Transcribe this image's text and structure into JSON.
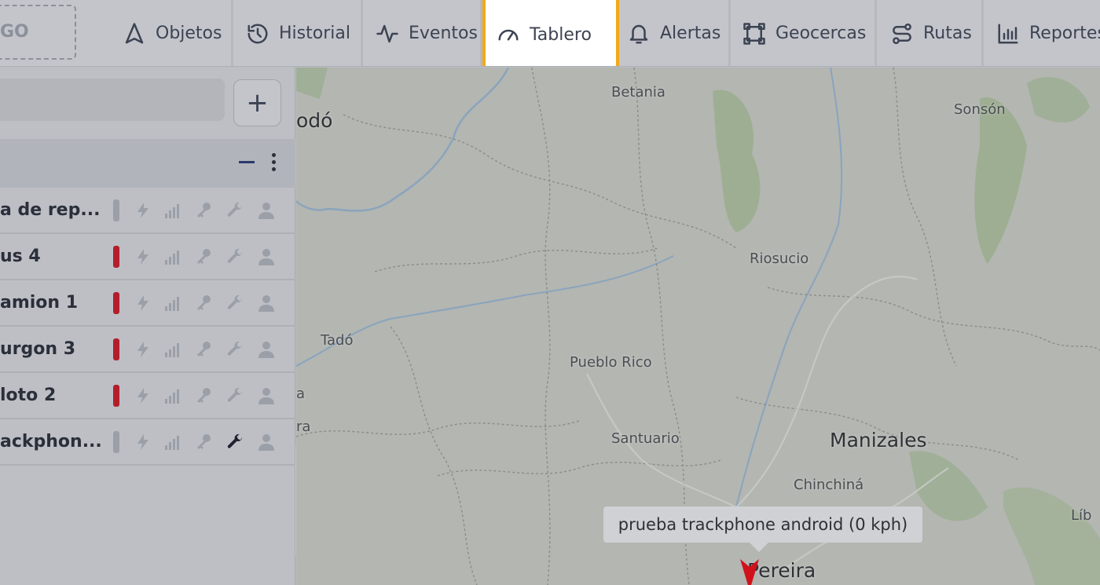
{
  "logo": {
    "text": "GO"
  },
  "nav": [
    {
      "label": "Objetos",
      "icon": "navigation-arrow-icon"
    },
    {
      "label": "Historial",
      "icon": "history-icon"
    },
    {
      "label": "Eventos",
      "icon": "activity-pulse-icon"
    },
    {
      "label": "Tablero",
      "icon": "gauge-icon",
      "active": true
    },
    {
      "label": "Alertas",
      "icon": "bell-icon"
    },
    {
      "label": "Geocercas",
      "icon": "geofence-square-icon"
    },
    {
      "label": "Rutas",
      "icon": "route-icon"
    },
    {
      "label": "Reportes",
      "icon": "bar-chart-icon"
    }
  ],
  "panel": {
    "add_label": "+",
    "objects": [
      {
        "name": "a de rep...",
        "status": "gray",
        "wrench_active": false
      },
      {
        "name": "us 4",
        "status": "red",
        "wrench_active": false
      },
      {
        "name": "amion 1",
        "status": "red",
        "wrench_active": false
      },
      {
        "name": "urgon 3",
        "status": "red",
        "wrench_active": false
      },
      {
        "name": "loto 2",
        "status": "red",
        "wrench_active": false
      },
      {
        "name": "ackphon...",
        "status": "gray",
        "wrench_active": true
      }
    ],
    "collapse_label": "‹"
  },
  "map": {
    "places": {
      "betania": "Betania",
      "sonson": "Sonsón",
      "quibdo": "odó",
      "riosucio": "Riosucio",
      "tado": "Tadó",
      "pueblo_rico": "Pueblo Rico",
      "santuario": "Santuario",
      "manizales": "Manizales",
      "chinchina": "Chinchiná",
      "pereira": "Pereira",
      "libano": "Líb",
      "edge_a": "a",
      "edge_ra": "ra"
    },
    "tooltip": "prueba trackphone android (0 kph)"
  },
  "colors": {
    "accent": "#f2a91a",
    "status_red": "#b21f2a",
    "marker": "#d0121b"
  }
}
